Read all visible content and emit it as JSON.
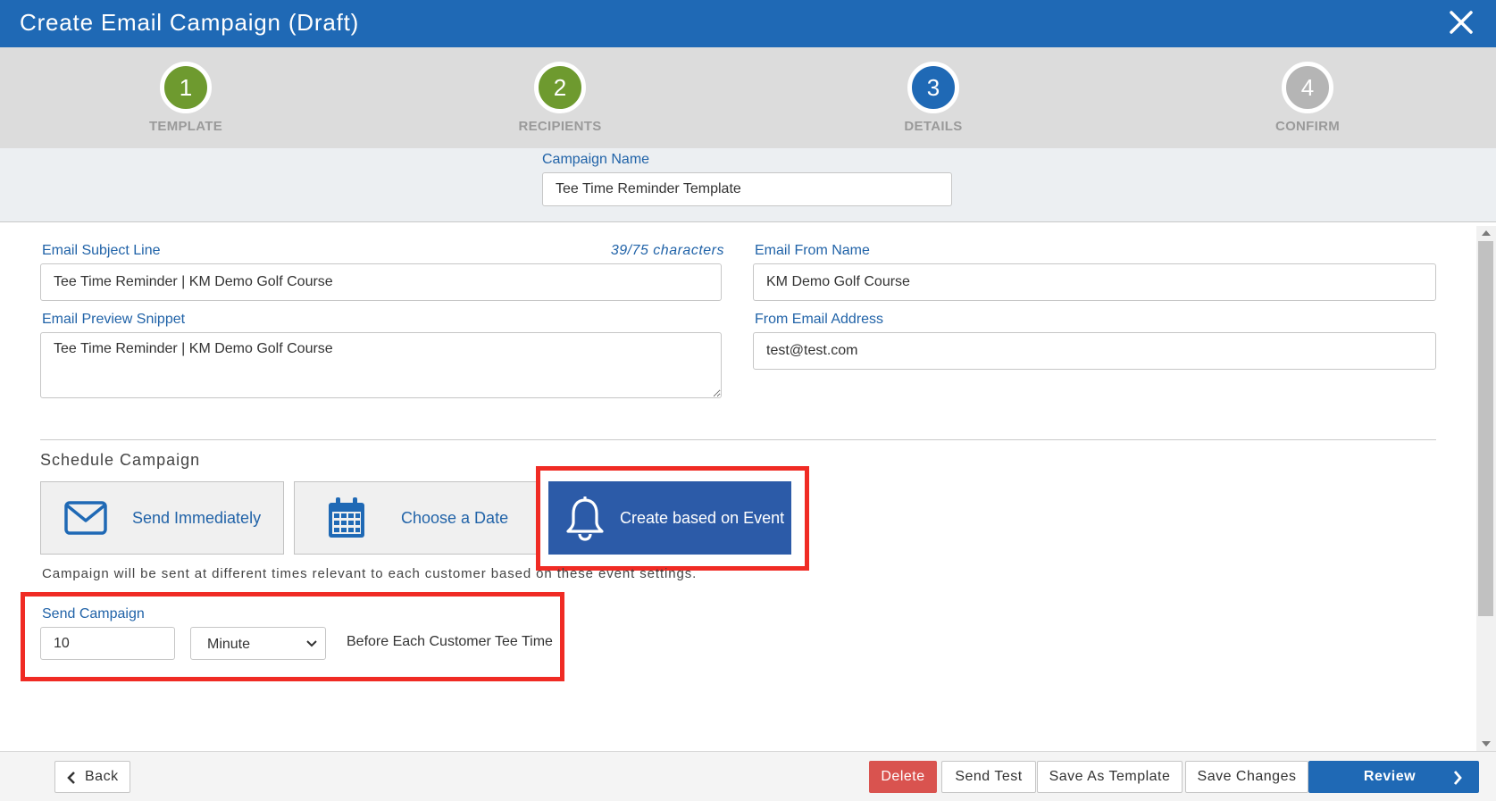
{
  "header": {
    "title": "Create Email Campaign (Draft)"
  },
  "steps": [
    {
      "number": "1",
      "label": "TEMPLATE",
      "state": "complete",
      "color": "#6e9a2f"
    },
    {
      "number": "2",
      "label": "RECIPIENTS",
      "state": "complete",
      "color": "#6e9a2f"
    },
    {
      "number": "3",
      "label": "DETAILS",
      "state": "current",
      "color": "#1f69b5"
    },
    {
      "number": "4",
      "label": "CONFIRM",
      "state": "pending",
      "color": "#b5b5b5"
    }
  ],
  "campaign": {
    "name_label": "Campaign Name",
    "name_value": "Tee Time Reminder Template"
  },
  "form": {
    "subject_label": "Email Subject Line",
    "subject_counter": "39/75 characters",
    "subject_value": "Tee Time Reminder | KM Demo Golf Course",
    "preview_label": "Email Preview Snippet",
    "preview_value": "Tee Time Reminder | KM Demo Golf Course",
    "from_name_label": "Email From Name",
    "from_name_value": "KM Demo Golf Course",
    "from_email_label": "From Email Address",
    "from_email_value": "test@test.com"
  },
  "schedule": {
    "title": "Schedule Campaign",
    "options": [
      {
        "label": "Send Immediately",
        "icon": "envelope-icon",
        "selected": false
      },
      {
        "label": "Choose a Date",
        "icon": "calendar-icon",
        "selected": false
      },
      {
        "label": "Create based on Event",
        "icon": "bell-icon",
        "selected": true
      }
    ],
    "hint": "Campaign will be sent at different times relevant to each customer based on these event settings.",
    "send_label": "Send Campaign",
    "send_value": "10",
    "unit_value": "Minute",
    "relation_text": "Before Each Customer Tee Time"
  },
  "footer": {
    "back": "Back",
    "delete": "Delete",
    "send_test": "Send Test",
    "save_as_template": "Save As Template",
    "save_changes": "Save Changes",
    "review": "Review"
  },
  "colors": {
    "header": "#1f69b5",
    "accent_blue": "#2163a8",
    "active_option": "#2c5ba8",
    "highlight": "#f02b24",
    "danger": "#d9534f",
    "complete_step": "#6e9a2f",
    "pending_step": "#b5b5b5"
  }
}
